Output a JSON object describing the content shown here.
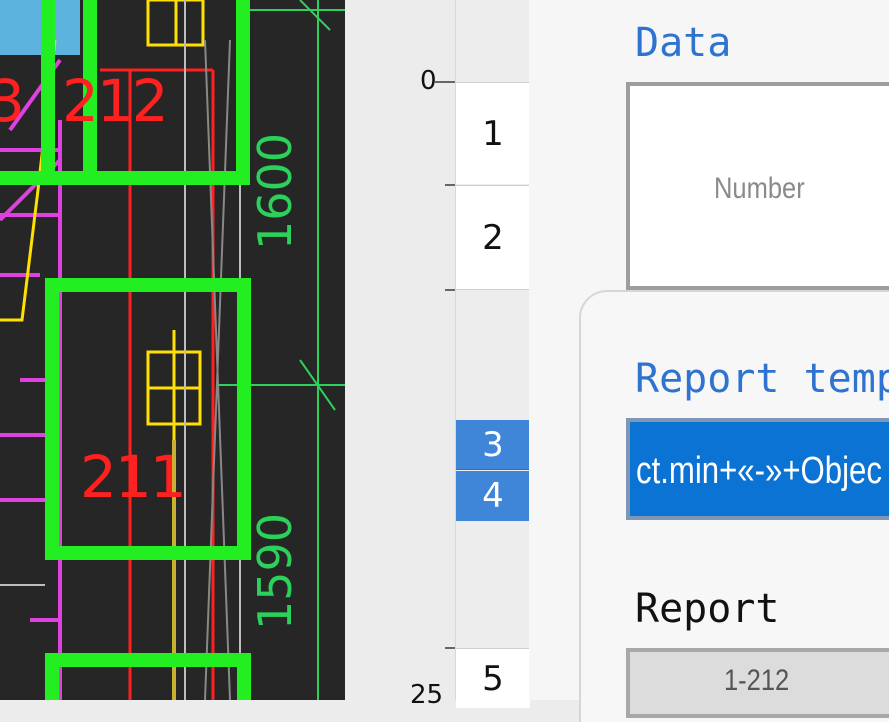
{
  "cad": {
    "room_labels": [
      "3",
      "212",
      "211"
    ],
    "dimension_labels": [
      "1600",
      "1590"
    ]
  },
  "ruler": {
    "top_mark": "0",
    "bottom_mark": "25",
    "rows": [
      "1",
      "2",
      "3",
      "4",
      "5"
    ]
  },
  "panel": {
    "data_label": "Data",
    "data_placeholder": "Number",
    "template_label": "Report temp",
    "template_value": "ct.min+«-»+Objec",
    "report_label": "Report",
    "report_value": "1-212"
  },
  "colors": {
    "room_outline": "#22ee22",
    "room_text": "#ff2020",
    "selection": "#3f86d8",
    "accent": "#2f73d1"
  }
}
